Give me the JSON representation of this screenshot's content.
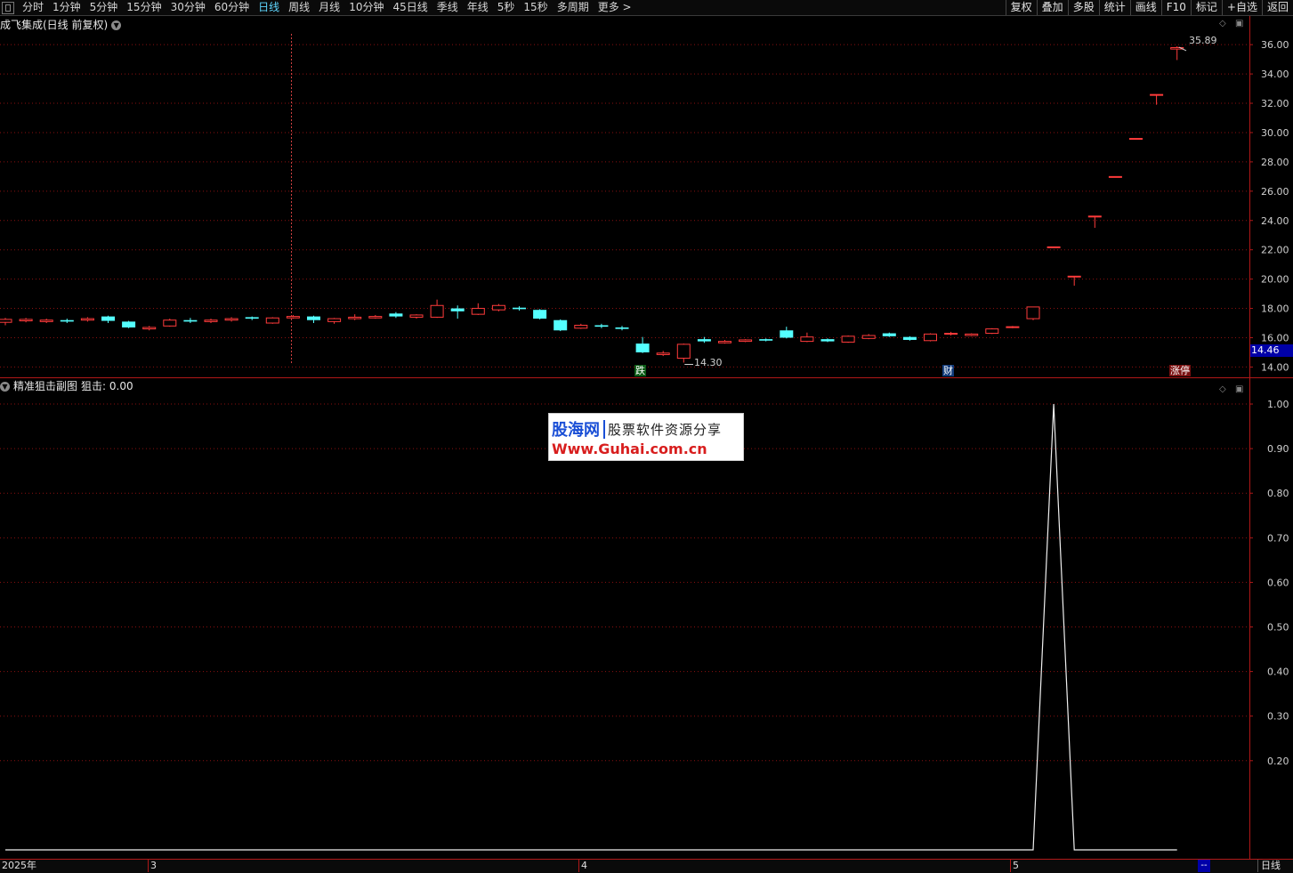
{
  "toolbar": {
    "periods": [
      "分时",
      "1分钟",
      "5分钟",
      "15分钟",
      "30分钟",
      "60分钟",
      "日线",
      "周线",
      "月线",
      "10分钟",
      "45日线",
      "季线",
      "年线",
      "5秒",
      "15秒",
      "多周期",
      "更多 >"
    ],
    "active_period": "日线",
    "right_buttons": [
      "复权",
      "叠加",
      "多股",
      "统计",
      "画线",
      "F10",
      "标记",
      "+自选",
      "返回"
    ]
  },
  "main_chart": {
    "title": "成飞集成(日线 前复权)",
    "y_labels": [
      "36.00",
      "34.00",
      "32.00",
      "30.00",
      "28.00",
      "26.00",
      "24.00",
      "22.00",
      "20.00",
      "18.00",
      "16.00",
      "14.00"
    ],
    "current_price": "14.46",
    "high_annotation": "35.89",
    "low_annotation": "14.30",
    "badges": {
      "die": "跌",
      "cai": "财",
      "zt": "涨停"
    },
    "colors": {
      "up": "#ff3b3b",
      "down": "#54ffff",
      "grid": "#8b1010",
      "axis": "#b01818"
    }
  },
  "sub_chart": {
    "title": "精准狙击副图",
    "value_label": "狙击: 0.00",
    "y_labels": [
      "1.00",
      "0.90",
      "0.80",
      "0.70",
      "0.60",
      "0.50",
      "0.40",
      "0.30",
      "0.20"
    ]
  },
  "watermark": {
    "logo": "股海网",
    "slogan": "股票软件资源分享",
    "url": "Www.Guhai.com.cn"
  },
  "bottom": {
    "dates": [
      "2025年",
      "3",
      "4",
      "5"
    ],
    "scroll_label": "--",
    "period_label": "日线"
  },
  "chart_data": {
    "type": "candlestick",
    "title": "成飞集成(日线 前复权)",
    "ylim": [
      13.6,
      36.8
    ],
    "candles": [
      {
        "o": 17.05,
        "c": 17.25,
        "h": 17.35,
        "l": 16.85
      },
      {
        "o": 17.15,
        "c": 17.25,
        "h": 17.35,
        "l": 17.05
      },
      {
        "o": 17.1,
        "c": 17.2,
        "h": 17.3,
        "l": 17.0
      },
      {
        "o": 17.2,
        "c": 17.1,
        "h": 17.3,
        "l": 17.0
      },
      {
        "o": 17.2,
        "c": 17.3,
        "h": 17.4,
        "l": 17.1
      },
      {
        "o": 17.45,
        "c": 17.15,
        "h": 17.5,
        "l": 17.0
      },
      {
        "o": 17.1,
        "c": 16.7,
        "h": 17.15,
        "l": 16.65
      },
      {
        "o": 16.6,
        "c": 16.7,
        "h": 16.8,
        "l": 16.5
      },
      {
        "o": 16.8,
        "c": 17.2,
        "h": 17.3,
        "l": 16.75
      },
      {
        "o": 17.2,
        "c": 17.1,
        "h": 17.35,
        "l": 17.0
      },
      {
        "o": 17.1,
        "c": 17.2,
        "h": 17.3,
        "l": 17.0
      },
      {
        "o": 17.2,
        "c": 17.3,
        "h": 17.4,
        "l": 17.1
      },
      {
        "o": 17.4,
        "c": 17.3,
        "h": 17.45,
        "l": 17.2
      },
      {
        "o": 17.0,
        "c": 17.35,
        "h": 17.4,
        "l": 16.95
      },
      {
        "o": 17.35,
        "c": 17.45,
        "h": 17.55,
        "l": 17.3
      },
      {
        "o": 17.45,
        "c": 17.2,
        "h": 17.5,
        "l": 17.0
      },
      {
        "o": 17.1,
        "c": 17.3,
        "h": 17.35,
        "l": 16.95
      },
      {
        "o": 17.3,
        "c": 17.4,
        "h": 17.6,
        "l": 17.2
      },
      {
        "o": 17.35,
        "c": 17.45,
        "h": 17.55,
        "l": 17.3
      },
      {
        "o": 17.65,
        "c": 17.45,
        "h": 17.75,
        "l": 17.35
      },
      {
        "o": 17.4,
        "c": 17.55,
        "h": 17.6,
        "l": 17.3
      },
      {
        "o": 17.4,
        "c": 18.2,
        "h": 18.6,
        "l": 17.35
      },
      {
        "o": 18.0,
        "c": 17.8,
        "h": 18.2,
        "l": 17.3
      },
      {
        "o": 17.6,
        "c": 18.0,
        "h": 18.35,
        "l": 17.55
      },
      {
        "o": 17.9,
        "c": 18.2,
        "h": 18.3,
        "l": 17.8
      },
      {
        "o": 18.05,
        "c": 17.95,
        "h": 18.15,
        "l": 17.85
      },
      {
        "o": 17.9,
        "c": 17.3,
        "h": 17.95,
        "l": 17.25
      },
      {
        "o": 17.2,
        "c": 16.5,
        "h": 17.25,
        "l": 16.45
      },
      {
        "o": 16.65,
        "c": 16.85,
        "h": 16.95,
        "l": 16.6
      },
      {
        "o": 16.85,
        "c": 16.75,
        "h": 16.95,
        "l": 16.65
      },
      {
        "o": 16.7,
        "c": 16.6,
        "h": 16.8,
        "l": 16.5
      },
      {
        "o": 15.6,
        "c": 15.0,
        "h": 16.05,
        "l": 14.95
      },
      {
        "o": 14.85,
        "c": 14.95,
        "h": 15.1,
        "l": 14.75
      },
      {
        "o": 14.6,
        "c": 15.55,
        "h": 15.6,
        "l": 14.3
      },
      {
        "o": 15.9,
        "c": 15.75,
        "h": 16.05,
        "l": 15.65
      },
      {
        "o": 15.65,
        "c": 15.75,
        "h": 15.85,
        "l": 15.6
      },
      {
        "o": 15.75,
        "c": 15.85,
        "h": 15.9,
        "l": 15.7
      },
      {
        "o": 15.9,
        "c": 15.8,
        "h": 15.95,
        "l": 15.75
      },
      {
        "o": 16.5,
        "c": 16.0,
        "h": 16.75,
        "l": 15.95
      },
      {
        "o": 15.75,
        "c": 16.05,
        "h": 16.35,
        "l": 15.7
      },
      {
        "o": 15.9,
        "c": 15.75,
        "h": 15.95,
        "l": 15.7
      },
      {
        "o": 15.7,
        "c": 16.1,
        "h": 16.15,
        "l": 15.65
      },
      {
        "o": 15.95,
        "c": 16.15,
        "h": 16.25,
        "l": 15.9
      },
      {
        "o": 16.3,
        "c": 16.1,
        "h": 16.35,
        "l": 16.05
      },
      {
        "o": 16.05,
        "c": 15.85,
        "h": 16.1,
        "l": 15.8
      },
      {
        "o": 15.8,
        "c": 16.25,
        "h": 16.3,
        "l": 15.75
      },
      {
        "o": 16.25,
        "c": 16.3,
        "h": 16.4,
        "l": 16.15
      },
      {
        "o": 16.15,
        "c": 16.25,
        "h": 16.3,
        "l": 16.1
      },
      {
        "o": 16.3,
        "c": 16.6,
        "h": 16.65,
        "l": 16.25
      },
      {
        "o": 16.7,
        "c": 16.75,
        "h": 16.8,
        "l": 16.65
      },
      {
        "o": 17.3,
        "c": 18.1,
        "h": 18.1,
        "l": 17.2
      },
      {
        "o": 22.2,
        "c": 22.2,
        "h": 22.2,
        "l": 22.2
      },
      {
        "o": 20.2,
        "c": 20.2,
        "h": 20.2,
        "l": 19.55
      },
      {
        "o": 24.3,
        "c": 24.3,
        "h": 24.3,
        "l": 23.5
      },
      {
        "o": 27.0,
        "c": 27.0,
        "h": 27.0,
        "l": 27.0
      },
      {
        "o": 29.6,
        "c": 29.6,
        "h": 29.6,
        "l": 29.6
      },
      {
        "o": 32.6,
        "c": 32.6,
        "h": 32.6,
        "l": 31.9
      },
      {
        "o": 35.7,
        "c": 35.8,
        "h": 35.89,
        "l": 34.95
      }
    ],
    "indicator": {
      "name": "狙击",
      "ylim": [
        0,
        1.02
      ],
      "values": [
        0,
        0,
        0,
        0,
        0,
        0,
        0,
        0,
        0,
        0,
        0,
        0,
        0,
        0,
        0,
        0,
        0,
        0,
        0,
        0,
        0,
        0,
        0,
        0,
        0,
        0,
        0,
        0,
        0,
        0,
        0,
        0,
        0,
        0,
        0,
        0,
        0,
        0,
        0,
        0,
        0,
        0,
        0,
        0,
        0,
        0,
        0,
        0,
        0,
        0,
        0,
        1,
        0,
        0,
        0,
        0,
        0,
        0
      ]
    }
  }
}
